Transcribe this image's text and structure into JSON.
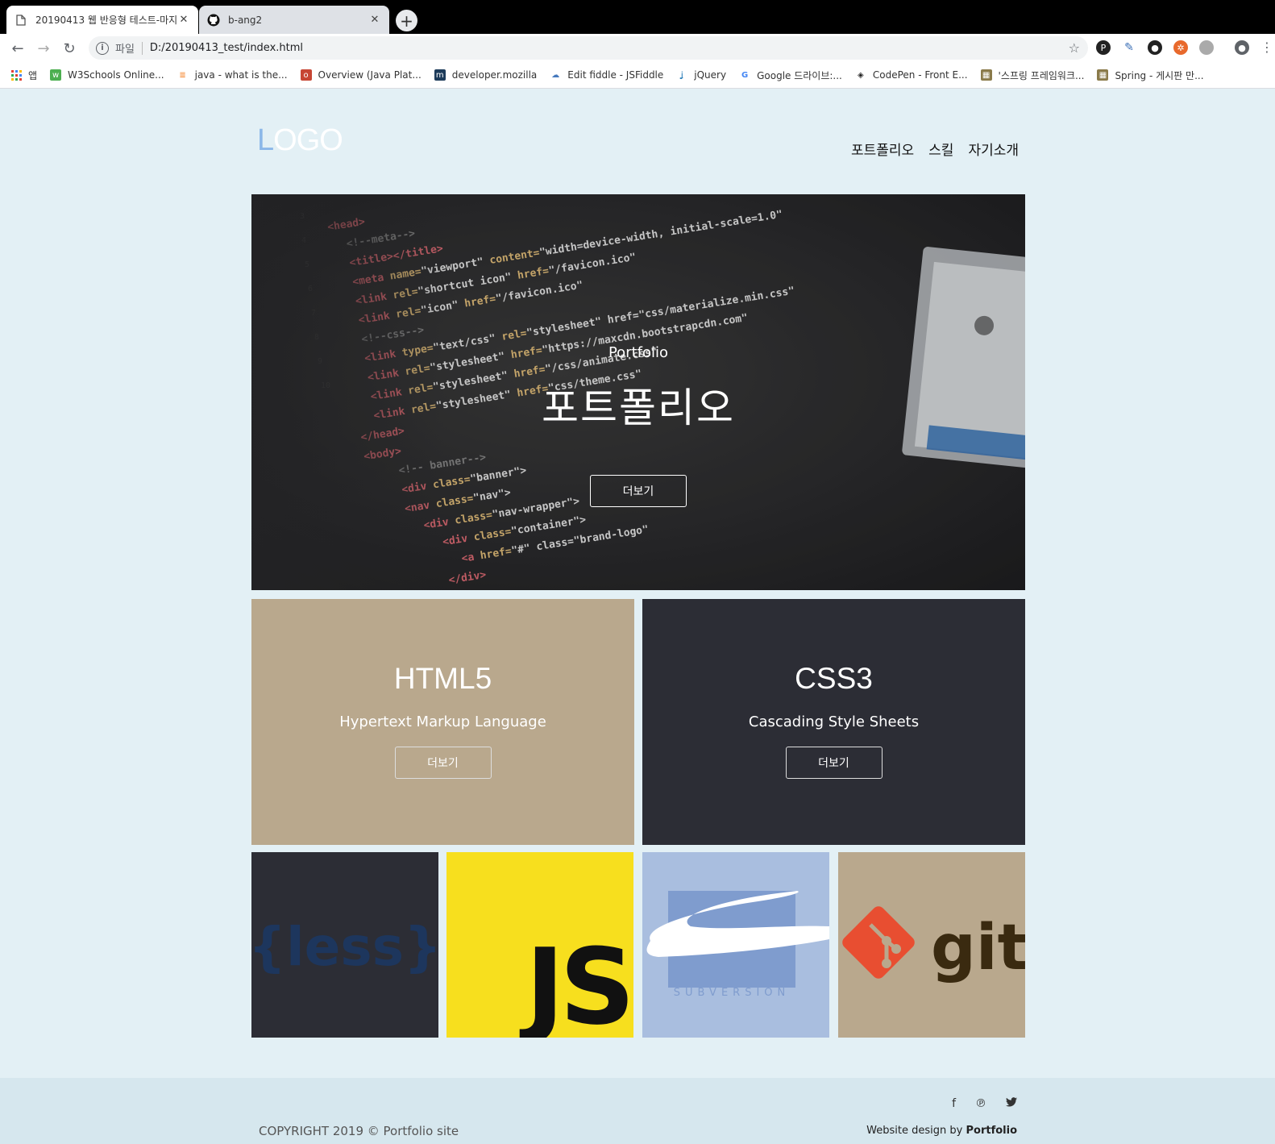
{
  "browser": {
    "tabs": [
      {
        "title": "20190413 웹 반응형 테스트-마지",
        "icon": "document-icon",
        "active": true
      },
      {
        "title": "b-ang2",
        "icon": "github-icon",
        "active": false
      }
    ],
    "new_tab": "+",
    "address": {
      "protocol": "파일",
      "url": "D:/20190413_test/index.html"
    },
    "bookmarks": [
      {
        "label": "앱",
        "icon": "apps-icon",
        "color": "#e34234"
      },
      {
        "label": "W3Schools Online...",
        "icon": "w3schools-icon",
        "color": "#4caf50"
      },
      {
        "label": "java - what is the...",
        "icon": "stackoverflow-icon",
        "color": "#f48024"
      },
      {
        "label": "Overview (Java Plat...",
        "icon": "oracle-icon",
        "color": "#c74634"
      },
      {
        "label": "developer.mozilla",
        "icon": "mozilla-icon",
        "color": "#1d3b5a"
      },
      {
        "label": "Edit fiddle - JSFiddle",
        "icon": "jsfiddle-icon",
        "color": "#4679bd"
      },
      {
        "label": "jQuery",
        "icon": "jquery-icon",
        "color": "#0769ad"
      },
      {
        "label": "Google 드라이브:...",
        "icon": "google-icon",
        "color": "#4285f4"
      },
      {
        "label": "CodePen - Front E...",
        "icon": "codepen-icon",
        "color": "#222222"
      },
      {
        "label": "'스프링 프레임워크...",
        "icon": "blog-icon",
        "color": "#8a7a4a"
      },
      {
        "label": "Spring - 게시판 만...",
        "icon": "blog-icon",
        "color": "#8a7a4a"
      }
    ]
  },
  "header": {
    "logo": "LOGO",
    "nav": [
      "포트폴리오",
      "스킬",
      "자기소개"
    ]
  },
  "hero": {
    "subtitle": "Portfolio",
    "title": "포트폴리오",
    "button": "더보기"
  },
  "cards": [
    {
      "title": "HTML5",
      "desc": "Hypertext Markup Language",
      "button": "더보기",
      "bg": "#b9a88d"
    },
    {
      "title": "CSS3",
      "desc": "Cascading Style Sheets",
      "button": "더보기",
      "bg": "#2c2d35"
    }
  ],
  "tiles": [
    {
      "name": "less",
      "text": "{less}",
      "bg": "#2c2d35"
    },
    {
      "name": "javascript",
      "text": "JS",
      "bg": "#f7df1e"
    },
    {
      "name": "subversion",
      "text": "SUBVERSION",
      "bg": "#a9bedf"
    },
    {
      "name": "git",
      "text": "git",
      "bg": "#b9a88d"
    }
  ],
  "footer": {
    "copyright": "COPYRIGHT 2019 © Portfolio site",
    "design_prefix": "Website design by",
    "design_brand": "Portfolio",
    "social": [
      {
        "icon": "facebook-icon",
        "glyph": "f"
      },
      {
        "icon": "pinterest-icon",
        "glyph": "℗"
      },
      {
        "icon": "twitter-icon",
        "glyph": "🐦"
      }
    ]
  }
}
